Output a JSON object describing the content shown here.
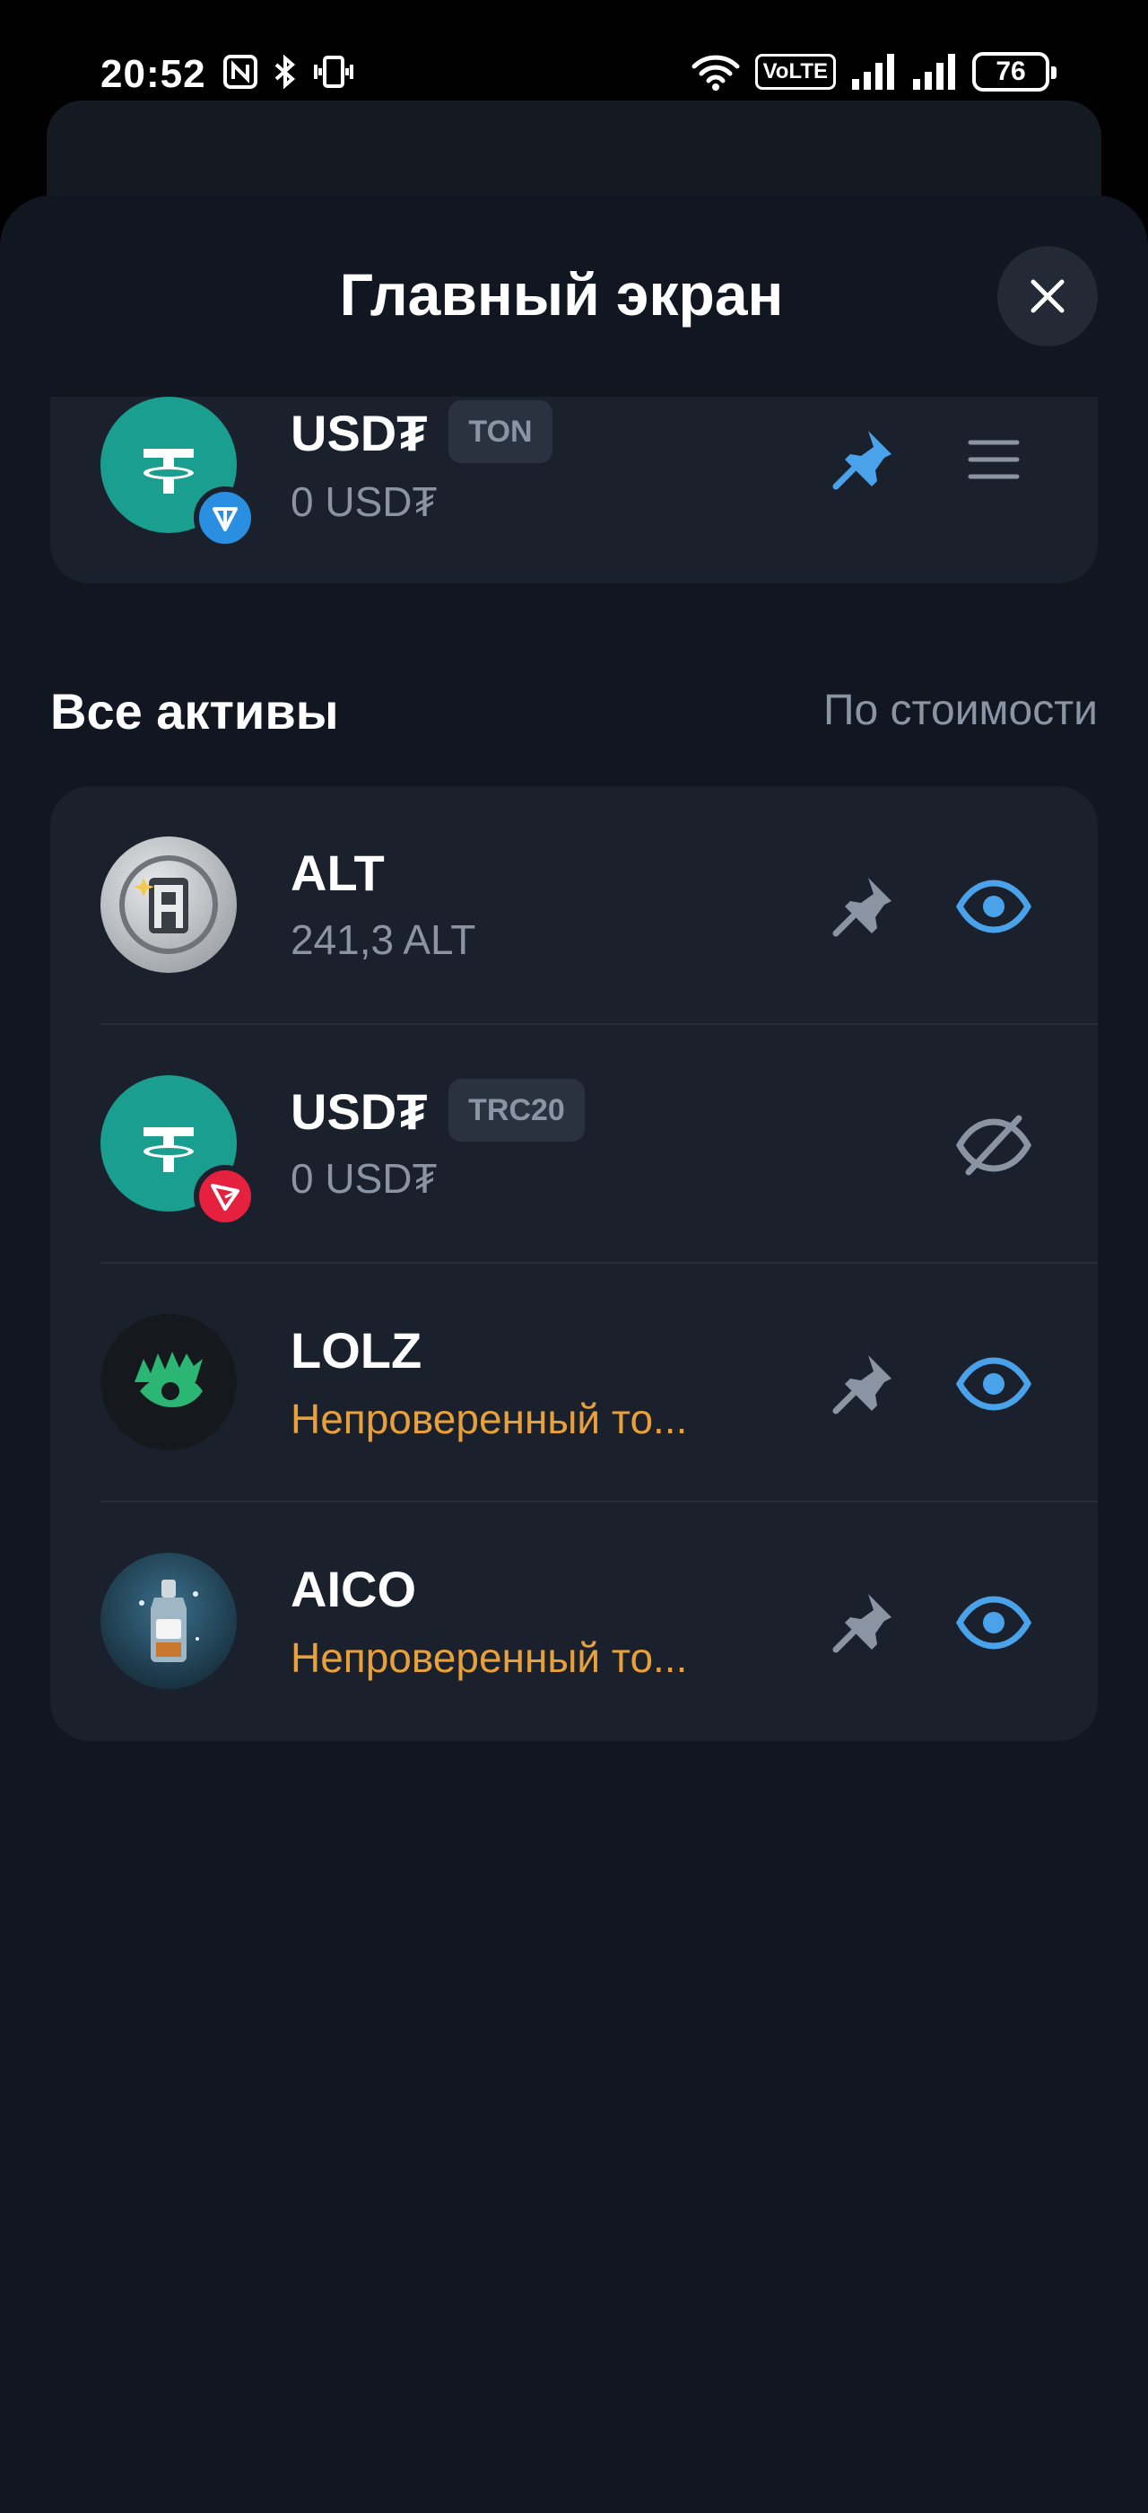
{
  "status_bar": {
    "time": "20:52",
    "volte": "VoLTE",
    "battery": "76"
  },
  "header": {
    "title": "Главный экран",
    "close_icon": "close-icon"
  },
  "pinned": [
    {
      "name": "USD₮",
      "network": "TON",
      "balance": "0 USD₮",
      "token_color": "#1a9e8f",
      "network_color": "#2a8fe0",
      "pin_color": "#4aa3ea"
    }
  ],
  "all_assets": {
    "title": "Все активы",
    "sort_label": "По стоимости",
    "items": [
      {
        "name": "ALT",
        "balance": "241,3 ALT",
        "pinned_icon": "pin-icon",
        "visible_icon": "eye-icon"
      },
      {
        "name": "USD₮",
        "network": "TRC20",
        "balance": "0 USD₮",
        "visible_icon": "eye-off-icon",
        "network_color": "#e5213f"
      },
      {
        "name": "LOLZ",
        "warning": "Непроверенный то...",
        "pinned_icon": "pin-icon",
        "visible_icon": "eye-icon"
      },
      {
        "name": "AICO",
        "warning": "Непроверенный то...",
        "pinned_icon": "pin-icon",
        "visible_icon": "eye-icon"
      }
    ]
  },
  "colors": {
    "background": "#111620",
    "card": "#1b212c",
    "accent_blue": "#4aa3ea",
    "warning": "#e8a13a",
    "muted": "#8a94a3"
  }
}
